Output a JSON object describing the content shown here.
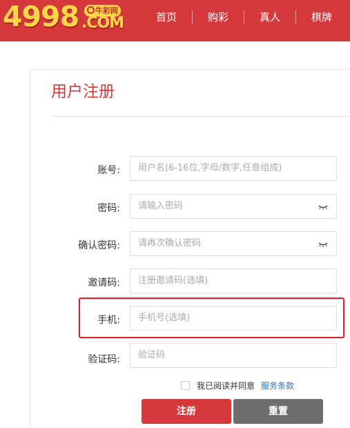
{
  "header": {
    "logo_main": "4998",
    "logo_com": ".COM",
    "logo_badge": "牛彩网",
    "nav": [
      "首页",
      "购彩",
      "真人",
      "棋牌"
    ]
  },
  "form": {
    "title": "用户注册",
    "fields": [
      {
        "label": "账号:",
        "placeholder": "用户名(6-16位,字母/数字,任意组成)"
      },
      {
        "label": "密码:",
        "placeholder": "请输入密码",
        "icon": "eye-closed-icon"
      },
      {
        "label": "确认密码:",
        "placeholder": "请再次确认密码",
        "icon": "eye-closed-icon"
      },
      {
        "label": "邀请码:",
        "placeholder": "注册邀请码(选填)"
      },
      {
        "label": "手机:",
        "placeholder": "手机号(选填)"
      },
      {
        "label": "验证码:",
        "placeholder": "验证码"
      }
    ],
    "agree_text": "我已阅读并同意",
    "terms_link": "服务条款",
    "submit_label": "注册",
    "reset_label": "重置"
  },
  "colors": {
    "brand_red": "#d4383b",
    "logo_gold": "#ffd54a",
    "highlight_red": "#e8191f",
    "link_blue": "#2f6fbd",
    "reset_gray": "#6d6d6d"
  }
}
